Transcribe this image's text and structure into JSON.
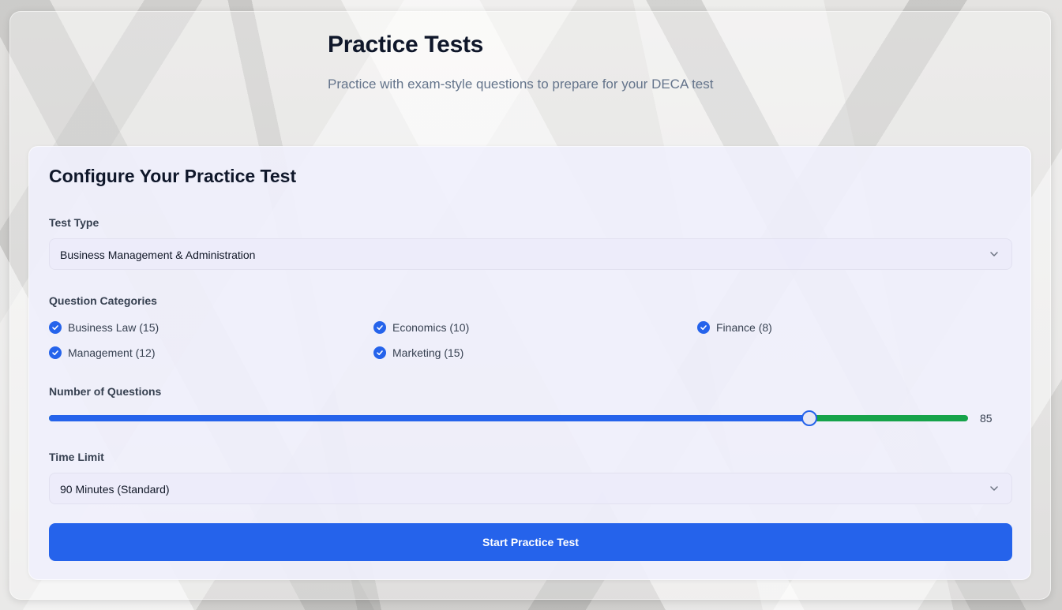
{
  "header": {
    "title": "Practice Tests",
    "subtitle": "Practice with exam-style questions to prepare for your DECA test"
  },
  "config": {
    "title": "Configure Your Practice Test",
    "test_type": {
      "label": "Test Type",
      "value": "Business Management & Administration"
    },
    "categories": {
      "label": "Question Categories",
      "items": [
        {
          "label": "Business Law (15)",
          "checked": true
        },
        {
          "label": "Economics (10)",
          "checked": true
        },
        {
          "label": "Finance (8)",
          "checked": true
        },
        {
          "label": "Management (12)",
          "checked": true
        },
        {
          "label": "Marketing (15)",
          "checked": true
        }
      ]
    },
    "questions": {
      "label": "Number of Questions",
      "value": "85",
      "level_fraction": 0.827
    },
    "time_limit": {
      "label": "Time Limit",
      "value": "90 Minutes (Standard)"
    },
    "start_button_label": "Start Practice Test"
  },
  "colors": {
    "accent": "#2563eb",
    "slider_remaining": "#16a34a"
  },
  "icons": {
    "select_chevron": "chevron-down-icon",
    "checkbox": "check-icon"
  }
}
